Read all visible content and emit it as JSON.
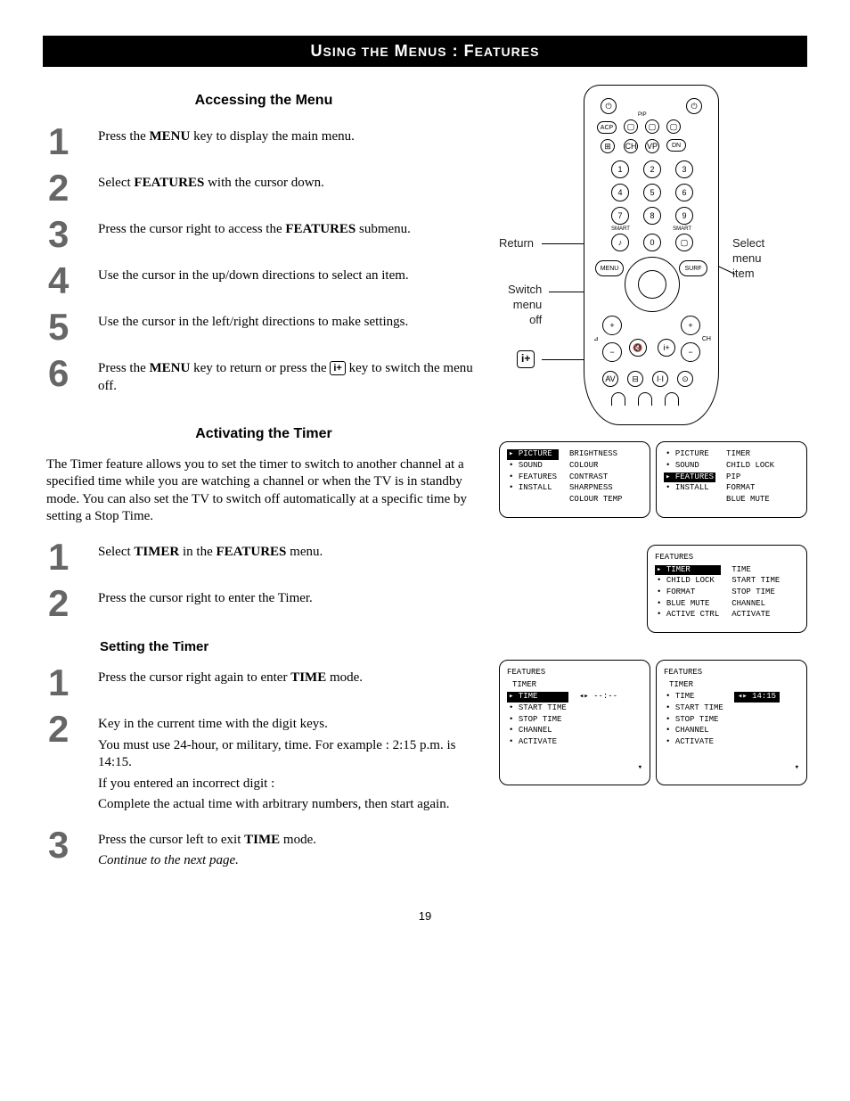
{
  "title_parts": {
    "a": "U",
    "b": "SING THE",
    "c": " M",
    "d": "ENUS",
    "e": " : F",
    "f": "EATURES"
  },
  "section1": "Accessing the Menu",
  "steps1": [
    {
      "n": "1",
      "pre": "Press the ",
      "b1": "MENU",
      "post": " key to display the main menu."
    },
    {
      "n": "2",
      "pre": "Select ",
      "b1": "FEATURES",
      "post": " with the cursor down."
    },
    {
      "n": "3",
      "pre": "Press the cursor right to access the ",
      "b1": "FEATURES",
      "post": " submenu."
    },
    {
      "n": "4",
      "pre": "Use the cursor in the up/down directions to select an item.",
      "b1": "",
      "post": ""
    },
    {
      "n": "5",
      "pre": "Use the cursor in the left/right directions to make settings.",
      "b1": "",
      "post": ""
    }
  ],
  "step6": {
    "n": "6",
    "a": "Press the ",
    "b": "MENU",
    "c": " key to return or press the ",
    "d": "i+",
    "e": " key to switch the menu off."
  },
  "section2": "Activating the Timer",
  "intro2": "The Timer feature allows you to set the timer to switch to another channel at a specified time while you are watching a channel or when the TV is in standby mode. You can also set the TV to switch off automatically at a specific time by setting a Stop Time.",
  "steps2a": [
    {
      "n": "1",
      "pre": "Select ",
      "b1": "TIMER",
      "mid": " in the ",
      "b2": "FEATURES",
      "post": " menu."
    },
    {
      "n": "2",
      "pre": "Press the cursor right to enter the Timer.",
      "b1": "",
      "mid": "",
      "b2": "",
      "post": ""
    }
  ],
  "section3": "Setting the Timer",
  "steps2b_1": {
    "n": "1",
    "a": "Press the cursor right again to enter ",
    "b": "TIME",
    "c": " mode."
  },
  "steps2b_2": {
    "n": "2",
    "l1": "Key in the current time with the digit keys.",
    "l2": "You must use 24-hour, or military, time. For example : 2:15 p.m. is 14:15.",
    "l3": "If you entered an incorrect digit :",
    "l4": "Complete the actual time with arbitrary numbers, then start again."
  },
  "steps2b_3": {
    "n": "3",
    "a": "Press the cursor left to exit ",
    "b": "TIME",
    "c": " mode.",
    "d": "Continue to the next page."
  },
  "page": "19",
  "remote_labels": {
    "ret": "Return",
    "switch": "Switch\nmenu\noff",
    "sel": "Select\nmenu\nitem",
    "info": "i+"
  },
  "osd": {
    "m1": {
      "left": [
        "PICTURE",
        "SOUND",
        "FEATURES",
        "INSTALL"
      ],
      "left_sel": 0,
      "right": [
        "BRIGHTNESS",
        "COLOUR",
        "CONTRAST",
        "SHARPNESS",
        "COLOUR TEMP"
      ]
    },
    "m2": {
      "left": [
        "PICTURE",
        "SOUND",
        "FEATURES",
        "INSTALL"
      ],
      "left_sel": 2,
      "right": [
        "TIMER",
        "CHILD LOCK",
        "PIP",
        "FORMAT",
        "BLUE MUTE"
      ]
    },
    "m3": {
      "hdr": "FEATURES",
      "left": [
        "TIMER",
        "CHILD LOCK",
        "FORMAT",
        "BLUE MUTE",
        "ACTIVE CTRL"
      ],
      "left_sel": 0,
      "right": [
        "TIME",
        "START TIME",
        "STOP TIME",
        "CHANNEL",
        "ACTIVATE"
      ]
    },
    "m4": {
      "hdr1": "FEATURES",
      "hdr2": "TIMER",
      "left": [
        "TIME",
        "START TIME",
        "STOP TIME",
        "CHANNEL",
        "ACTIVATE"
      ],
      "left_sel": 0,
      "val": "--:--"
    },
    "m5": {
      "hdr1": "FEATURES",
      "hdr2": "TIMER",
      "left": [
        "TIME",
        "START TIME",
        "STOP TIME",
        "CHANNEL",
        "ACTIVATE"
      ],
      "left_sel_val_only": 0,
      "val": "14:15"
    }
  },
  "remote_keys": [
    "1",
    "2",
    "3",
    "4",
    "5",
    "6",
    "7",
    "8",
    "9",
    "0"
  ]
}
